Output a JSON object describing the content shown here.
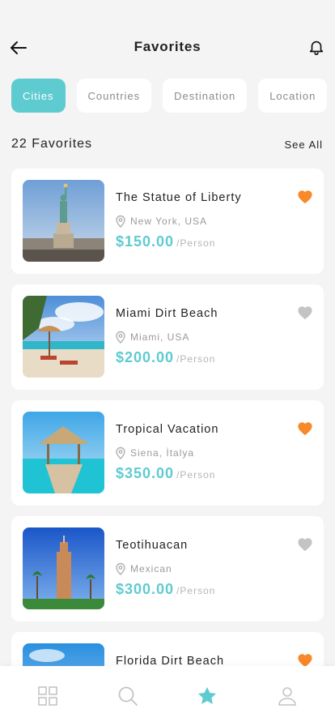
{
  "header": {
    "title": "Favorites"
  },
  "tabs": [
    {
      "label": "Cities",
      "active": true
    },
    {
      "label": "Countries",
      "active": false
    },
    {
      "label": "Destination",
      "active": false
    },
    {
      "label": "Location",
      "active": false
    }
  ],
  "list_header": {
    "title": "22 Favorites",
    "see_all": "See All"
  },
  "items": [
    {
      "name": "The Statue of Liberty",
      "location": "New York, USA",
      "price": "$150.00",
      "unit": "/Person",
      "favorite": true
    },
    {
      "name": "Miami Dirt Beach",
      "location": "Miami, USA",
      "price": "$200.00",
      "unit": "/Person",
      "favorite": false
    },
    {
      "name": "Tropical Vacation",
      "location": "Siena, İtalya",
      "price": "$350.00",
      "unit": "/Person",
      "favorite": true
    },
    {
      "name": "Teotihuacan",
      "location": "Mexican",
      "price": "$300.00",
      "unit": "/Person",
      "favorite": false
    },
    {
      "name": "Florida Dirt Beach",
      "location": "",
      "price": "",
      "unit": "",
      "favorite": true
    }
  ],
  "nav": [
    {
      "icon": "grid-icon",
      "active": false
    },
    {
      "icon": "search-icon",
      "active": false
    },
    {
      "icon": "star-icon",
      "active": true
    },
    {
      "icon": "user-icon",
      "active": false
    }
  ],
  "colors": {
    "accent": "#5ecbd0",
    "heart_active": "#f7892a",
    "heart_inactive": "#c4c4c4"
  }
}
